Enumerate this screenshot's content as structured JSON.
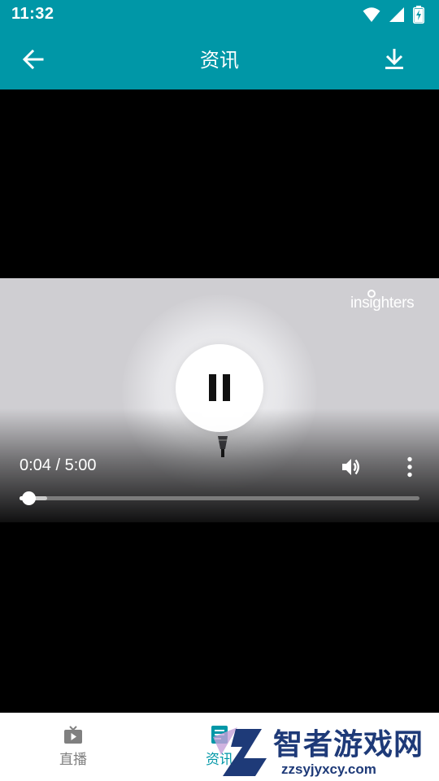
{
  "status_bar": {
    "time": "11:32"
  },
  "app_bar": {
    "title": "资讯",
    "back_icon": "arrow-left-icon",
    "download_icon": "download-icon"
  },
  "player": {
    "brand_logo": "insighters",
    "state": "playing",
    "control_icon": "pause-icon",
    "time_display": "0:04 / 5:00",
    "progress_fraction": 0.013,
    "buffer_fraction": 0.07,
    "volume_icon": "volume-icon",
    "menu_icon": "more-vertical-icon"
  },
  "bottom_nav": {
    "items": [
      {
        "label": "直播",
        "icon": "tv-icon",
        "active": false
      },
      {
        "label": "资讯",
        "icon": "news-icon",
        "active": true
      }
    ],
    "active_color": "#0097a7",
    "inactive_color": "#808080"
  },
  "watermark": {
    "site_name": "智者游戏网",
    "site_url": "zzsyjyxcy.com"
  },
  "colors": {
    "primary": "#0097a7"
  }
}
